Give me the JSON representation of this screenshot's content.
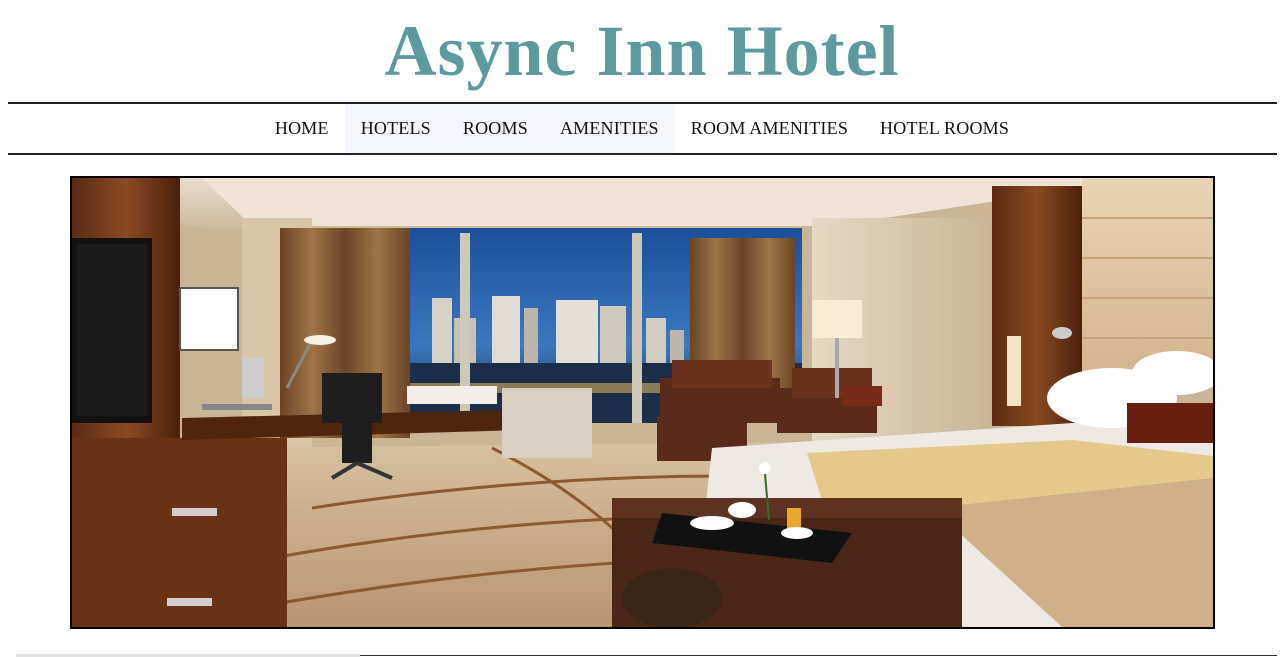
{
  "header": {
    "title": "Async Inn Hotel",
    "title_color": "#5b9a9e"
  },
  "nav": {
    "items": [
      {
        "label": "HOME"
      },
      {
        "label": "HOTELS"
      },
      {
        "label": "ROOMS"
      },
      {
        "label": "AMENITIES"
      },
      {
        "label": "ROOM AMENITIES"
      },
      {
        "label": "HOTEL ROOMS"
      }
    ],
    "highlight_color": "#f5f6fc"
  },
  "hero": {
    "image_subject": "hotel-room-photo"
  }
}
